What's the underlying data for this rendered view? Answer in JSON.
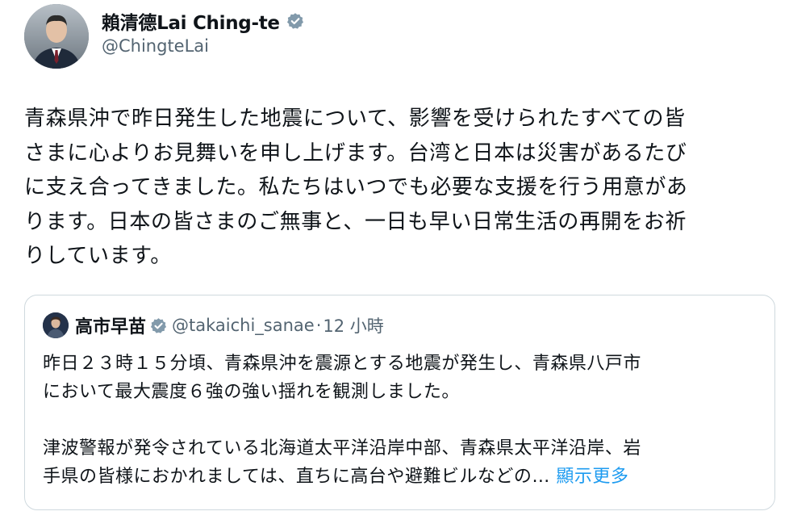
{
  "author": {
    "display_name": "賴清德Lai Ching-te",
    "handle": "@ChingteLai",
    "verified_icon": "verified-badge-icon"
  },
  "tweet": {
    "lines": [
      "青森県沖で昨日発生した地震について、影響を受けられたすべての皆",
      "さまに心よりお見舞いを申し上げます。台湾と日本は災害があるたび",
      "に支え合ってきました。私たちはいつでも必要な支援を行う用意があ",
      "ります。日本の皆さまのご無事と、一日も早い日常生活の再開をお祈",
      "りしています。"
    ]
  },
  "quote": {
    "display_name": "高市早苗",
    "handle": "@takaichi_sanae",
    "separator": "·",
    "time": "12 小時",
    "paragraph1": [
      "昨日２３時１５分頃、青森県沖を震源とする地震が発生し、青森県八戸市",
      "において最大震度６強の強い揺れを観測しました。"
    ],
    "paragraph2": [
      "津波警報が発令されている北海道太平洋沿岸中部、青森県太平洋沿岸、岩",
      "手県の皆様におかれましては、直ちに高台や避難ビルなどの…"
    ],
    "show_more": "顯示更多"
  },
  "colors": {
    "text": "#0f1419",
    "secondary": "#536471",
    "link": "#1d9bf0",
    "border": "#cfd9de"
  }
}
